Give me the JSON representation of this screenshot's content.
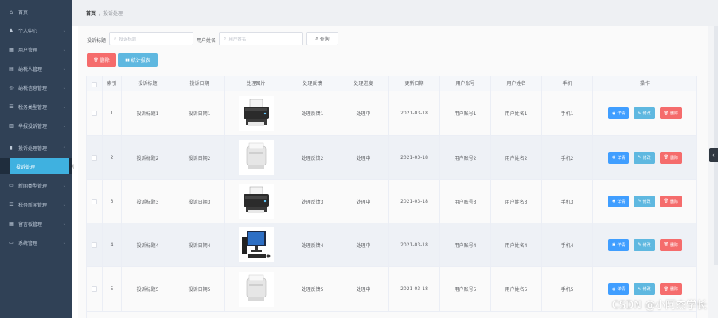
{
  "sidebar": {
    "items": [
      {
        "icon": "home-icon",
        "glyph": "⌂",
        "label": "首页",
        "arrow": false
      },
      {
        "icon": "user-icon",
        "glyph": "♟",
        "label": "个人中心",
        "arrow": true
      },
      {
        "icon": "users-icon",
        "glyph": "▦",
        "label": "用户管理",
        "arrow": true
      },
      {
        "icon": "taxpayer-icon",
        "glyph": "▤",
        "label": "纳税人管理",
        "arrow": true
      },
      {
        "icon": "info-icon",
        "glyph": "◎",
        "label": "纳税信息管理",
        "arrow": true
      },
      {
        "icon": "tax-type-icon",
        "glyph": "☰",
        "label": "税务类型管理",
        "arrow": true
      },
      {
        "icon": "report-icon",
        "glyph": "▥",
        "label": "举报投诉管理",
        "arrow": true
      },
      {
        "icon": "complaint-icon",
        "glyph": "▮",
        "label": "投诉处理管理",
        "arrow": true
      },
      {
        "icon": "news-type-icon",
        "glyph": "▭",
        "label": "新闻类型管理",
        "arrow": true
      },
      {
        "icon": "tax-news-icon",
        "glyph": "☰",
        "label": "税务新闻管理",
        "arrow": true
      },
      {
        "icon": "message-board-icon",
        "glyph": "▦",
        "label": "留言板管理",
        "arrow": true
      },
      {
        "icon": "system-icon",
        "glyph": "▭",
        "label": "系统管理",
        "arrow": true
      }
    ],
    "active_sub": "投诉处理"
  },
  "breadcrumb": {
    "home": "首页",
    "separator": "/",
    "current": "投诉处理"
  },
  "search": {
    "title_label": "投诉标题",
    "title_placeholder": "投诉标题",
    "name_label": "用户姓名",
    "name_placeholder": "用户姓名",
    "query_label": "查询"
  },
  "toolbar": {
    "delete_label": "删除",
    "stats_label": "统计报表"
  },
  "table": {
    "columns": [
      "",
      "索引",
      "投诉标题",
      "投诉日期",
      "处理图片",
      "处理反馈",
      "处理进度",
      "更新日期",
      "用户账号",
      "用户姓名",
      "手机",
      "操作"
    ],
    "actions": {
      "detail": "详情",
      "edit": "修改",
      "delete": "删除"
    },
    "rows": [
      {
        "index": "1",
        "title": "投诉标题1",
        "date": "投诉日期1",
        "image": "printer-icon",
        "feedback": "处理反馈1",
        "progress": "处理中",
        "updated": "2021-03-18",
        "account": "用户账号1",
        "name": "用户姓名1",
        "phone": "手机1"
      },
      {
        "index": "2",
        "title": "投诉标题2",
        "date": "投诉日期2",
        "image": "laser-printer-icon",
        "feedback": "处理反馈2",
        "progress": "处理中",
        "updated": "2021-03-18",
        "account": "用户账号2",
        "name": "用户姓名2",
        "phone": "手机2"
      },
      {
        "index": "3",
        "title": "投诉标题3",
        "date": "投诉日期3",
        "image": "printer-icon",
        "feedback": "处理反馈3",
        "progress": "处理中",
        "updated": "2021-03-18",
        "account": "用户账号3",
        "name": "用户姓名3",
        "phone": "手机3"
      },
      {
        "index": "4",
        "title": "投诉标题4",
        "date": "投诉日期4",
        "image": "computer-icon",
        "feedback": "处理反馈4",
        "progress": "处理中",
        "updated": "2021-03-18",
        "account": "用户账号4",
        "name": "用户姓名4",
        "phone": "手机4"
      },
      {
        "index": "5",
        "title": "投诉标题5",
        "date": "投诉日期5",
        "image": "laser-printer-icon",
        "feedback": "处理反馈5",
        "progress": "处理中",
        "updated": "2021-03-18",
        "account": "用户账号5",
        "name": "用户姓名5",
        "phone": "手机5"
      }
    ]
  },
  "watermark": "CSDN @小阿杰学长",
  "colors": {
    "sidebar": "#304156",
    "active": "#3fb1e0",
    "danger": "#f56c6c",
    "primary": "#409eff",
    "info": "#5fb8e0"
  }
}
